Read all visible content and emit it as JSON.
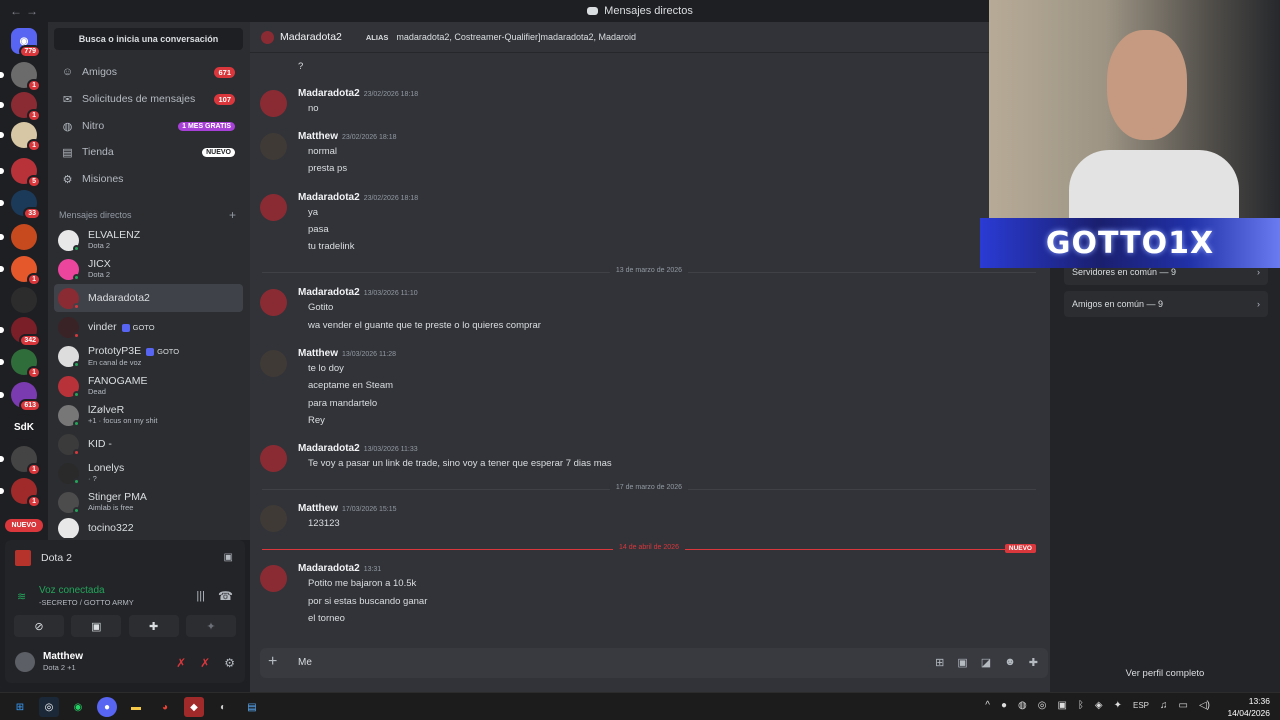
{
  "window": {
    "title": "Mensajes directos"
  },
  "servers": [
    {
      "label": "",
      "badge": "779",
      "color": "#5865f2"
    },
    {
      "label": "",
      "badge": "1",
      "color": "#6b6b6b"
    },
    {
      "label": "",
      "badge": "1",
      "color": "#8a2b33"
    },
    {
      "label": "",
      "badge": "1",
      "color": "#d8c7a4"
    },
    {
      "label": "",
      "badge": "5",
      "color": "#b8323a"
    },
    {
      "label": "",
      "badge": "33",
      "color": "#1b3a5a"
    },
    {
      "label": "",
      "badge": "",
      "color": "#c64a1e"
    },
    {
      "label": "",
      "badge": "1",
      "color": "#e4582c"
    },
    {
      "label": "",
      "badge": "",
      "color": "#2c2c2c"
    },
    {
      "label": "",
      "badge": "342",
      "color": "#7a1e28"
    },
    {
      "label": "",
      "badge": "1",
      "color": "#2f6d3a"
    },
    {
      "label": "",
      "badge": "613",
      "color": "#7b3bb0"
    },
    {
      "label": "SdK",
      "badge": "",
      "color": "#1e1f22"
    },
    {
      "label": "",
      "badge": "1",
      "color": "#444"
    },
    {
      "label": "",
      "badge": "1",
      "color": "#a02a2a"
    }
  ],
  "servers_new_label": "NUEVO",
  "dm_sidebar": {
    "search_label": "Busca o inicia una conversación",
    "nav": [
      {
        "label": "Amigos",
        "count": "671"
      },
      {
        "label": "Solicitudes de mensajes",
        "count": "107"
      },
      {
        "label": "Nitro",
        "pill": "1 MES GRATIS"
      },
      {
        "label": "Tienda",
        "pill": "NUEVO"
      },
      {
        "label": "Misiones"
      }
    ],
    "header": "Mensajes directos",
    "dms": [
      {
        "name": "ELVALENZ",
        "sub": "Dota 2",
        "tag": ""
      },
      {
        "name": "JICX",
        "sub": "Dota 2",
        "tag": ""
      },
      {
        "name": "Madaradota2",
        "sub": "",
        "tag": ""
      },
      {
        "name": "vinder",
        "sub": "",
        "tag": "GOTO"
      },
      {
        "name": "PrototyP3E",
        "sub": "En canal de voz",
        "tag": "GOTO"
      },
      {
        "name": "FANOGAME",
        "sub": "Dead",
        "tag": ""
      },
      {
        "name": "lZølveR",
        "sub": "+1 · focus on my shit",
        "tag": ""
      },
      {
        "name": "KID -",
        "sub": "",
        "tag": ""
      },
      {
        "name": "Lonelys",
        "sub": "· ?",
        "tag": ""
      },
      {
        "name": "Stinger PMA",
        "sub": "Aimlab is free",
        "tag": ""
      },
      {
        "name": "tocino322",
        "sub": "",
        "tag": ""
      }
    ]
  },
  "user_panel": {
    "game": "Dota 2",
    "voice_status": "Voz conectada",
    "voice_channel": "-SECRETO / GOTTO ARMY",
    "username": "Matthew",
    "activity": "Dota 2 +1"
  },
  "chat": {
    "header_name": "Madaradota2",
    "alias_label": "ALIAS",
    "aliases": "madaradota2, Costreamer-Qualifier]madaradota2, Madaroid",
    "top_fragment": "?",
    "messages": [
      {
        "author": "Madaradota2",
        "time": "23/02/2026 18:18",
        "lines": [
          "no"
        ]
      },
      {
        "author": "Matthew",
        "time": "23/02/2026 18:18",
        "lines": [
          "normal",
          "presta ps"
        ]
      },
      {
        "author": "Madaradota2",
        "time": "23/02/2026 18:18",
        "lines": [
          "ya",
          "pasa",
          "tu tradelink"
        ]
      },
      {
        "author": "Madaradota2",
        "time": "13/03/2026 11:10",
        "lines": [
          "Gotito",
          "wa vender el guante que te preste o lo quieres comprar"
        ]
      },
      {
        "author": "Matthew",
        "time": "13/03/2026 11:28",
        "lines": [
          "te lo doy",
          "aceptame en Steam",
          "para mandartelo",
          "Rey"
        ]
      },
      {
        "author": "Madaradota2",
        "time": "13/03/2026 11:33",
        "lines": [
          "Te voy a pasar un link de trade, sino voy a tener que esperar 7 dias mas"
        ]
      },
      {
        "author": "Matthew",
        "time": "17/03/2026 15:15",
        "lines": [
          "123123"
        ]
      },
      {
        "author": "Madaradota2",
        "time": "13:31",
        "lines": [
          "Potito me bajaron a 10.5k",
          "por si estas buscando ganar",
          "el torneo"
        ]
      }
    ],
    "separators": [
      "13 de marzo de 2026",
      "17 de marzo de 2026",
      "14 de abril de 2026"
    ],
    "new_label": "NUEVO",
    "composer_text": "Me"
  },
  "profile": {
    "servers_common": "Servidores en común — 9",
    "friends_common": "Amigos en común — 9",
    "view_full": "Ver perfil completo"
  },
  "stream": {
    "overlay_text": "GOTTO1X"
  },
  "taskbar": {
    "lang": "ESP",
    "time": "13:36",
    "date": "14/04/2026"
  }
}
